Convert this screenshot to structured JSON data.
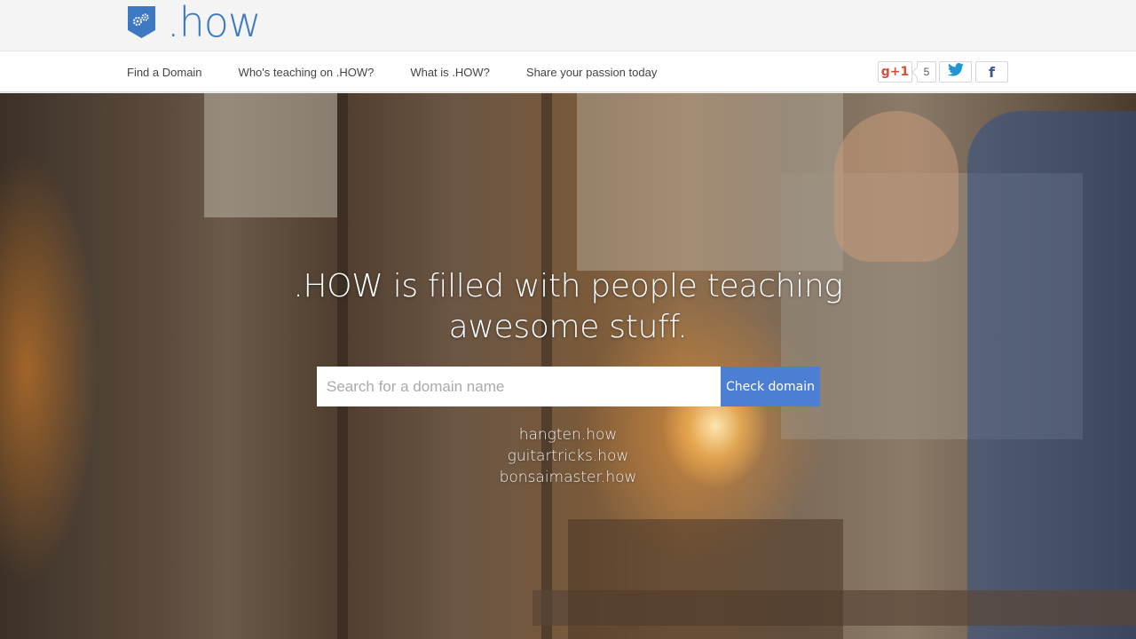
{
  "brand": {
    "logo_text": ".how",
    "logo_icon": "gears-badge-icon",
    "accent_color": "#3d79c3"
  },
  "nav": {
    "items": [
      {
        "label": "Find a Domain"
      },
      {
        "label": "Who's teaching on .HOW?"
      },
      {
        "label": "What is .HOW?"
      },
      {
        "label": "Share your passion today"
      }
    ]
  },
  "social": {
    "gplus_label": "g+1",
    "gplus_count": "5",
    "twitter_icon": "twitter-bird-icon",
    "facebook_label": "f"
  },
  "hero": {
    "title": ".HOW is filled with people teaching awesome stuff.",
    "search": {
      "placeholder": "Search for a domain name",
      "value": "",
      "button_label": "Check domain",
      "button_color": "#4c7fd4"
    },
    "examples": [
      {
        "label": "hangten.how"
      },
      {
        "label": "guitartricks.how"
      },
      {
        "label": "bonsaimaster.how"
      }
    ]
  }
}
